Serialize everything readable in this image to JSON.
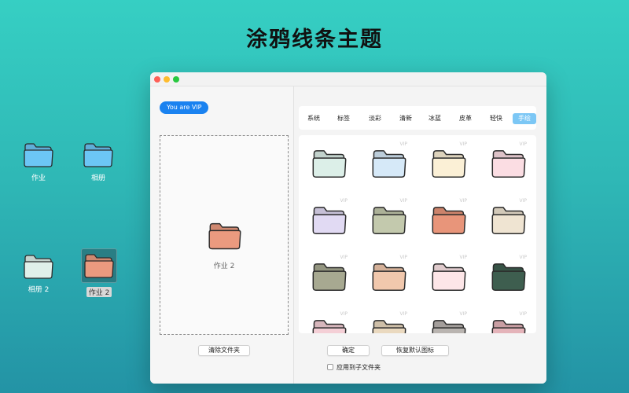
{
  "headline": "涂鸦线条主题",
  "desktop": {
    "icons": [
      {
        "label": "作业",
        "color": "#6cc6f5"
      },
      {
        "label": "相册",
        "color": "#6cc6f5"
      },
      {
        "label": "相册 2",
        "color": "#dff0ea"
      },
      {
        "label": "作业 2",
        "color": "#eb9a7f"
      }
    ]
  },
  "window": {
    "vip_badge": "You are VIP",
    "drop_zone_label": "作业 2",
    "drop_zone_folder_color": "#eb9a7f",
    "clear_button": "清除文件夹",
    "tabs": [
      {
        "label": "系统"
      },
      {
        "label": "标签"
      },
      {
        "label": "淡彩"
      },
      {
        "label": "清新"
      },
      {
        "label": "冰蓝"
      },
      {
        "label": "皮革"
      },
      {
        "label": "轻快"
      },
      {
        "label": "手绘",
        "active": true
      }
    ],
    "folders": [
      {
        "color": "#dcefe8",
        "vip": false
      },
      {
        "color": "#d6e9f8",
        "vip": true
      },
      {
        "color": "#fbf0d6",
        "vip": true
      },
      {
        "color": "#fbdde3",
        "vip": true
      },
      {
        "color": "#e1daf3",
        "vip": true
      },
      {
        "color": "#c3c9ad",
        "vip": true
      },
      {
        "color": "#e8957a",
        "vip": true
      },
      {
        "color": "#efe4d2",
        "vip": true
      },
      {
        "color": "#a7a991",
        "vip": true
      },
      {
        "color": "#f1c8ad",
        "vip": true
      },
      {
        "color": "#fde6e8",
        "vip": true
      },
      {
        "color": "#3e5e4f",
        "vip": true
      },
      {
        "color": "#f4cfd6",
        "vip": true
      },
      {
        "color": "#ead9bf",
        "vip": true
      },
      {
        "color": "#b9b4b0",
        "vip": true
      },
      {
        "color": "#e4b3b9",
        "vip": true
      }
    ],
    "vip_tag": "VIP",
    "ok_button": "确定",
    "restore_button": "恢复默认图标",
    "apply_subfolders": "应用到子文件夹"
  }
}
